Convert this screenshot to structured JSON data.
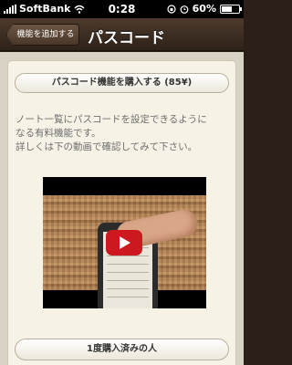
{
  "status_bar": {
    "carrier": "SoftBank",
    "time": "0:28",
    "battery": "60%",
    "battery_level": 0.6
  },
  "nav": {
    "back_label": "機能を追加する",
    "title": "パスコード"
  },
  "main": {
    "purchase_label": "パスコード機能を購入する (85¥)",
    "description_lines": [
      "ノート一覧にパスコードを設定できるように",
      "なる有料機能です。",
      "詳しくは下の動画で確認してみて下さい。"
    ],
    "purchased_label": "1度購入済みの人"
  },
  "colors": {
    "nav_background": "#3d2e23",
    "card_background": "#f6f2e6",
    "play_button": "#cc181e"
  }
}
